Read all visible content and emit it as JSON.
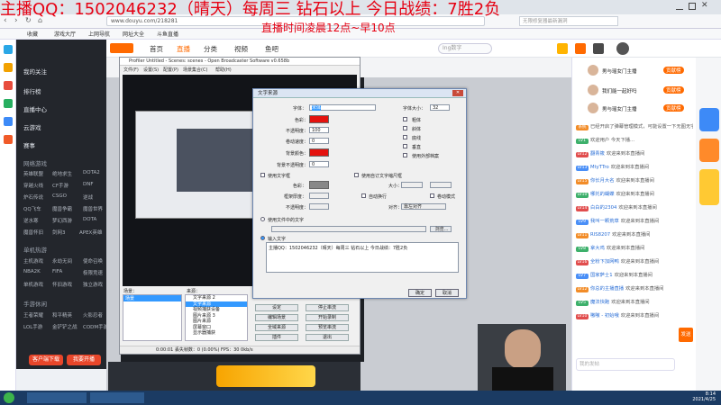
{
  "overlay": {
    "title": "主播QQ：1502046232（晴天）每周三 钻石以上 今日战绩：7胜2负",
    "subtitle": "直播时间凌晨12点~早10点"
  },
  "browser": {
    "url": "www.douyu.com/218281",
    "search_placeholder": "无限修复器最新漏洞",
    "bookmarks": [
      "收藏",
      "游戏大厅",
      "上网导航",
      "网址大全",
      "斗鱼直播"
    ]
  },
  "sidebar": {
    "items": [
      "我的关注",
      "排行榜",
      "直播中心",
      "云游戏",
      "赛事"
    ],
    "section_online": "网络游戏",
    "online_games": [
      "英雄联盟",
      "绝地求生",
      "DOTA2",
      "穿越火线",
      "CF手游",
      "DNF",
      "炉石传说",
      "CSGO",
      "逆战",
      "QQ飞车",
      "魔兽争霸",
      "魔兽世界",
      "逆水寒",
      "梦幻西游",
      "DOTA",
      "魔兽怀旧",
      "剑网3",
      "APEX英雄"
    ],
    "section_mobile": "单机热游",
    "mobile_games": [
      "主机游戏",
      "永劫无间",
      "使命召唤",
      "NBA2K",
      "FIFA",
      "极限竞速",
      "单机游戏",
      "怀旧游戏",
      "独立游戏"
    ],
    "section_other": "手游休闲",
    "other_games": [
      "王者荣耀",
      "和平精英",
      "火影忍者",
      "LOL手游",
      "金铲铲之战",
      "CODM手游"
    ],
    "btn_download": "客户端下载",
    "btn_live": "我要开播"
  },
  "topnav": {
    "items": [
      "首页",
      "直播",
      "分类",
      "视频",
      "鱼吧"
    ],
    "search_placeholder": "Ing数字"
  },
  "obs": {
    "title": "Profiler Untitled - Scenes: scenes - Open Broadcaster Software v0.658b",
    "menu": [
      "文件(F)",
      "设置(S)",
      "配置(P)",
      "场景集合(C)",
      "帮助(H)"
    ],
    "scenes_label": "场景：",
    "sources_label": "来源：",
    "scene_item": "场景",
    "sources": [
      "文字来源 2",
      "文字来源",
      "视频捕获设备",
      "图片来源 3",
      "图片来源",
      "屏幕窗口",
      "显示器捕获"
    ],
    "buttons": [
      "设定",
      "编辑场景",
      "全域来源",
      "插件",
      "停止串流",
      "开始录制",
      "预览串流",
      "退出"
    ],
    "status": "0:00:01    丢失帧数：0 (0.00%)    FPS：30    0kb/s"
  },
  "dialog": {
    "title": "文字来源",
    "font_label": "字体：",
    "font_value": "宋体",
    "size_label": "字体大小：",
    "size_value": "32",
    "color_label": "色彩：",
    "opacity_label": "不透明度：",
    "opacity_value": "100",
    "scroll_label": "卷动速度：",
    "scroll_value": "0",
    "bg_label": "背景颜色：",
    "bg_opacity_label": "背景不透明度：",
    "bg_opacity_value": "0",
    "bold": "粗体",
    "italic": "斜体",
    "underline": "底线",
    "vertical": "垂直",
    "outline_label": "使用外部档案",
    "use_outline": "使用文字框",
    "outline_color": "色彩：",
    "outline_thickness": "框架厚度：",
    "outline_opacity": "不透明度：",
    "custom_size": "使用自订文字缩尺框",
    "size_w": "大小：",
    "wrap": "自动换行",
    "scroll_only": "卷动模式",
    "align": "对齐：",
    "align_value": "靠左对齐",
    "use_file": "使用文件中的文字",
    "browse": "浏览...",
    "input_text": "输入文字",
    "text_value": "主播QQ：1502046232（晴天）每周三 钻石以上 今日战绩：7胜2负",
    "ok": "确定",
    "cancel": "取消"
  },
  "chat": {
    "rank": [
      {
        "name": "男与瑶女门主播",
        "tag": "贡献榜"
      },
      {
        "name": "我们能一起好吗",
        "tag": "贡献榜"
      },
      {
        "name": "男与瑶女门主播",
        "tag": "贡献榜"
      }
    ],
    "messages": [
      {
        "lvl": "系统",
        "text": "已经开启了弹幕管理模式，可能设置一下无图无字幕..."
      },
      {
        "lvl": "LV1",
        "text": "欢迎用户 今天下播..."
      },
      {
        "lvl": "LV12",
        "user": "翻青筱",
        "text": "欢迎来到本直播间"
      },
      {
        "lvl": "LV13",
        "user": "MtyTTro",
        "text": "欢迎来到本直播间"
      },
      {
        "lvl": "LV15",
        "user": "你长月大名",
        "text": "欢迎来到本直播间"
      },
      {
        "lvl": "LV10",
        "user": "哪托的蝴蝶",
        "text": "欢迎来到本直播间"
      },
      {
        "lvl": "LV14",
        "user": "白白的2304",
        "text": "欢迎来到本直播间"
      },
      {
        "lvl": "LV9",
        "user": "我叫一颗荒草",
        "text": "欢迎来到本直播间"
      },
      {
        "lvl": "LV11",
        "user": "RIS8207",
        "text": "欢迎来到本直播间"
      },
      {
        "lvl": "LV8",
        "user": "拿大鸡",
        "text": "欢迎来到本直播间"
      },
      {
        "lvl": "LV16",
        "user": "全粉下加网鸭",
        "text": "欢迎来到本直播间"
      },
      {
        "lvl": "LV7",
        "user": "国家萨士1",
        "text": "欢迎来到本直播间"
      },
      {
        "lvl": "LV12",
        "user": "你总的主播直播",
        "text": "欢迎来到本直播间"
      },
      {
        "lvl": "LV5",
        "user": "魔法快跑",
        "text": "欢迎来到本直播间"
      },
      {
        "lvl": "LV10",
        "user": "嗷嗷 - 初始哦",
        "text": "欢迎来到本直播间"
      }
    ],
    "input_placeholder": "我的发帖",
    "send": "发送"
  },
  "clock": {
    "time": "8:14",
    "date": "2021/4/25"
  },
  "colors": {
    "accent": "#e60012",
    "douyu_orange": "#ff6a00",
    "sidebar": "#23262c"
  }
}
